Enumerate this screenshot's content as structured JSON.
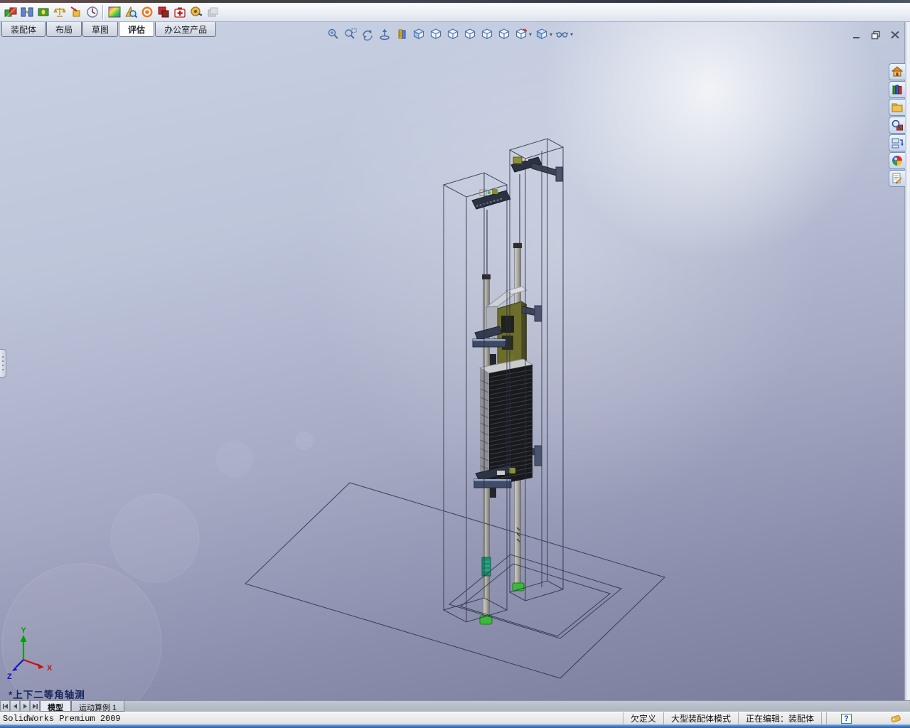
{
  "command_manager": {
    "tabs": [
      {
        "label": "装配体",
        "active": false
      },
      {
        "label": "布局",
        "active": false
      },
      {
        "label": "草图",
        "active": false
      },
      {
        "label": "评估",
        "active": true
      },
      {
        "label": "办公室产品",
        "active": false
      }
    ],
    "tools": [
      {
        "icon": "interference-detection-icon"
      },
      {
        "icon": "clearance-verification-icon"
      },
      {
        "icon": "hole-alignment-icon"
      },
      {
        "icon": "measure-icon"
      },
      {
        "icon": "mass-properties-icon"
      },
      {
        "icon": "section-properties-icon"
      },
      {
        "icon": "curvature-icon"
      },
      {
        "icon": "draft-analysis-icon"
      },
      {
        "icon": "zebra-stripes-icon"
      },
      {
        "icon": "assembly-visualization-icon"
      },
      {
        "icon": "simulationxpress-icon"
      },
      {
        "icon": "measure-tape-icon"
      },
      {
        "icon": "dfmxpress-icon-disabled"
      }
    ]
  },
  "heads_up": {
    "items": [
      {
        "icon": "zoom-to-fit-icon"
      },
      {
        "icon": "zoom-to-area-icon"
      },
      {
        "icon": "previous-view-icon"
      },
      {
        "icon": "section-view-icon"
      },
      {
        "icon": "view-orientation-icon"
      },
      {
        "icon": "isometric-view-icon"
      },
      {
        "icon": "front-view-icon"
      },
      {
        "icon": "back-view-icon"
      },
      {
        "icon": "left-view-icon"
      },
      {
        "icon": "right-view-icon"
      },
      {
        "icon": "top-view-icon"
      },
      {
        "icon": "hide-show-items-icon",
        "caret": "▾"
      },
      {
        "icon": "display-style-icon",
        "caret": "▾"
      },
      {
        "icon": "view-settings-icon",
        "caret": "▾"
      }
    ]
  },
  "window_controls": {
    "minimize": "minimize-window",
    "restore": "restore-window",
    "close": "close-window"
  },
  "task_pane": {
    "items": [
      {
        "icon": "solidworks-resources-icon"
      },
      {
        "icon": "design-library-icon"
      },
      {
        "icon": "file-explorer-icon"
      },
      {
        "icon": "search-icon"
      },
      {
        "icon": "view-palette-icon"
      },
      {
        "icon": "appearances-scenes-icon"
      },
      {
        "icon": "custom-properties-icon"
      }
    ]
  },
  "viewport": {
    "view_label": "*上下二等角轴测",
    "triad": {
      "x": "X",
      "y": "Y",
      "z": "Z"
    }
  },
  "bottom_tabs": {
    "nav": [
      "first-tab",
      "previous-tab",
      "next-tab",
      "last-tab"
    ],
    "tabs": [
      {
        "label": "模型",
        "active": true
      },
      {
        "label": "运动算例 1",
        "active": false
      }
    ]
  },
  "status_bar": {
    "app_version": "SolidWorks Premium 2009",
    "items": [
      "欠定义",
      "大型装配体模式",
      "正在编辑：装配体"
    ],
    "help_glyph": "?",
    "tag_icon": "note-tag-icon"
  },
  "colors": {
    "triad_x": "#cc1010",
    "triad_y": "#00a000",
    "triad_z": "#1010cc",
    "viewport_top": "#c9d1e4",
    "viewport_bottom": "#797c9b",
    "taskbar_blue": "#2e62ae",
    "model_olive": "#6d6d2b",
    "model_green_foot": "#3db83d"
  }
}
